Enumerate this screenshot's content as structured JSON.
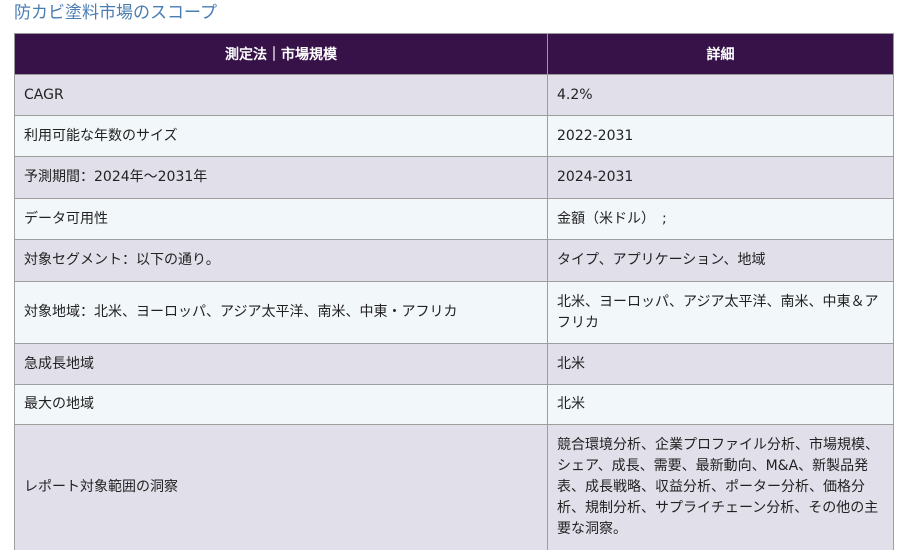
{
  "heading": "防カビ塗料市場のスコープ",
  "table": {
    "headers": [
      "測定法｜市場規模",
      "詳細"
    ],
    "rows": [
      {
        "label": "CAGR",
        "value": "4.2%"
      },
      {
        "label": "利用可能な年数のサイズ",
        "value": "2022-2031"
      },
      {
        "label": "予測期間：2024年～2031年",
        "value": "2024-2031"
      },
      {
        "label": "データ可用性",
        "value": "金額（米ドル）　;"
      },
      {
        "label": "対象セグメント：以下の通り。",
        "value": "タイプ、アプリケーション、地域"
      },
      {
        "label": "対象地域：北米、ヨーロッパ、アジア太平洋、南米、中東・アフリカ",
        "value": "北米、ヨーロッパ、アジア太平洋、南米、中東＆アフリカ"
      },
      {
        "label": "急成長地域",
        "value": "北米"
      },
      {
        "label": "最大の地域",
        "value": "北米"
      },
      {
        "label": "レポート対象範囲の洞察",
        "value": "競合環境分析、企業プロファイル分析、市場規模、シェア、成長、需要、最新動向、M&A、新製品発表、成長戦略、収益分析、ポーター分析、価格分析、規制分析、サプライチェーン分析、その他の主要な洞察。"
      }
    ]
  },
  "colors": {
    "heading_text": "#4a7db3",
    "header_background": "#361249",
    "row_odd": "#e1dfea",
    "row_even": "#f2f7fa"
  }
}
